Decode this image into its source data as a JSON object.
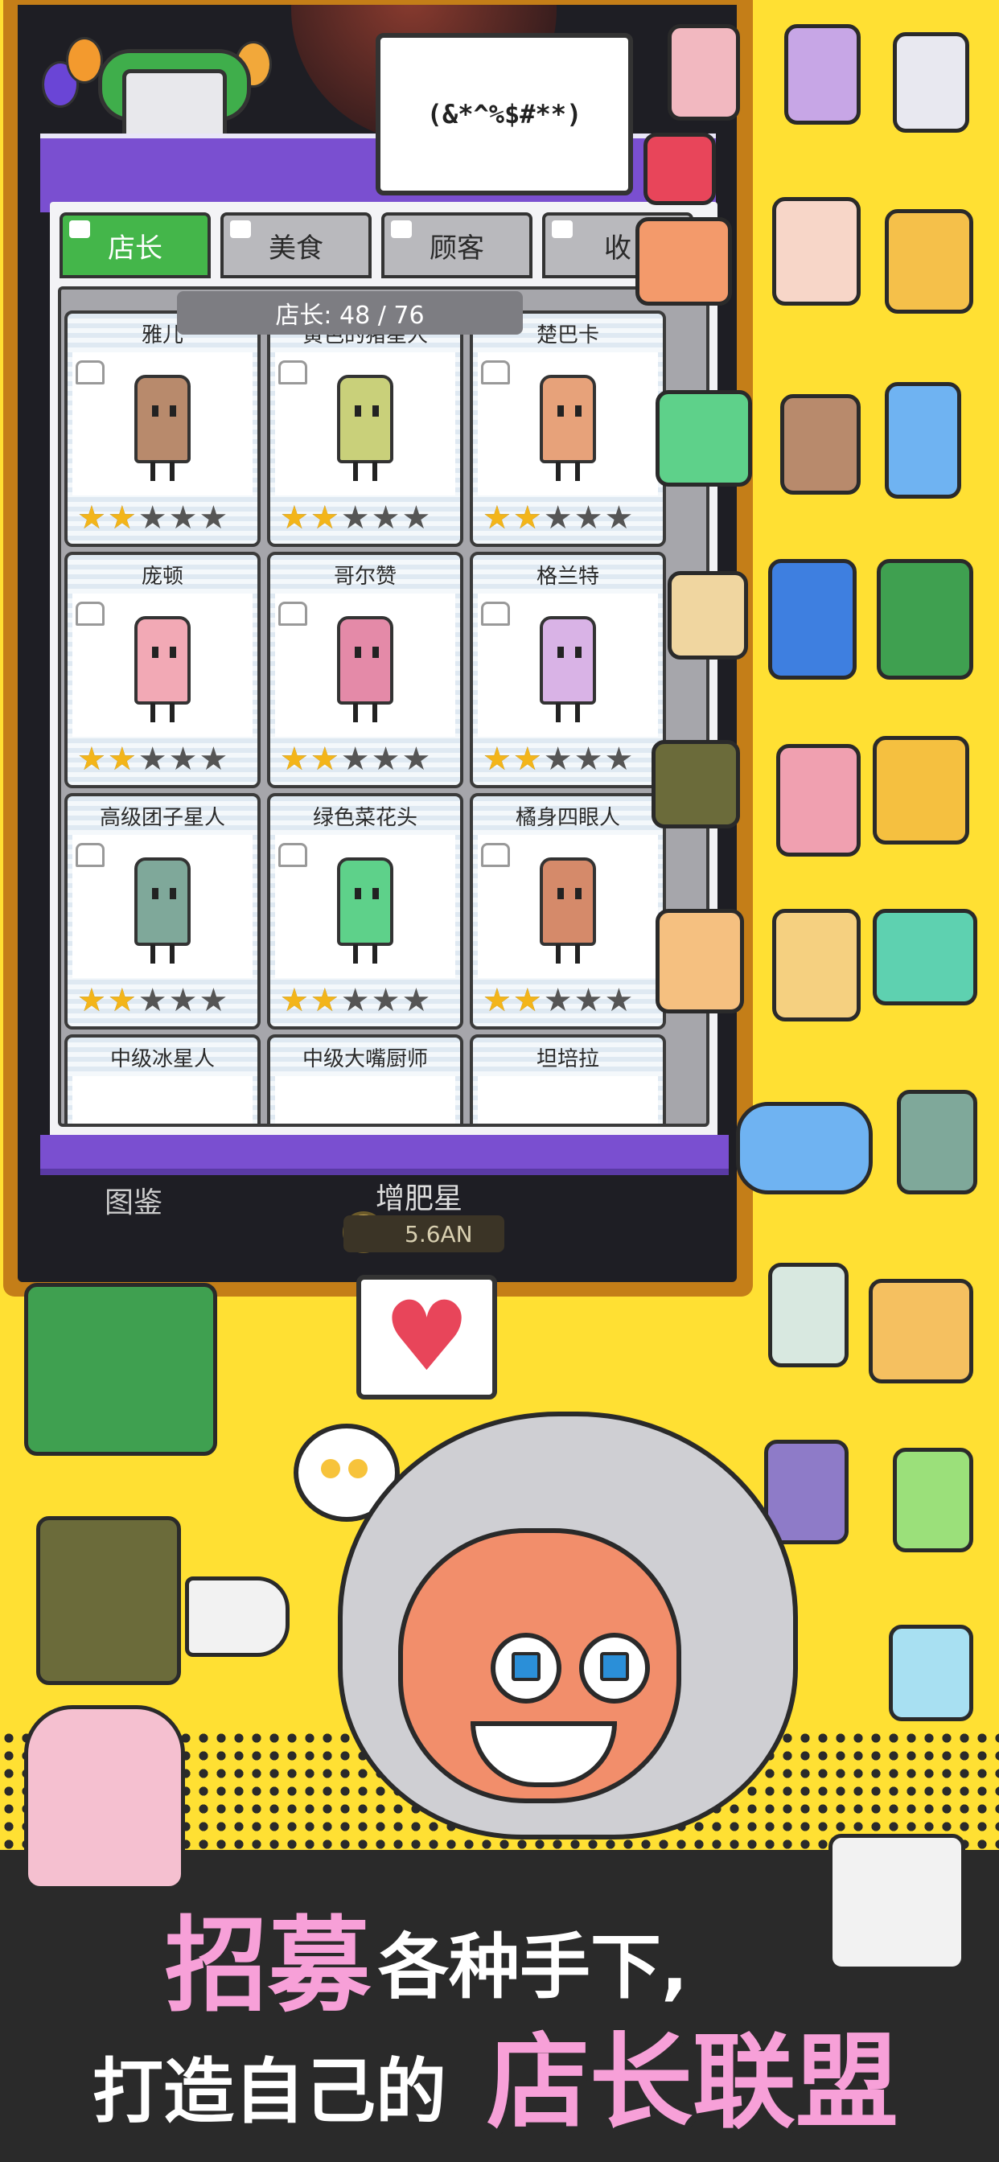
{
  "bubble_text": "(&*^%$#**)",
  "tabs": [
    {
      "label": "店长",
      "active": true
    },
    {
      "label": "美食",
      "active": false
    },
    {
      "label": "顾客",
      "active": false
    },
    {
      "label": "收",
      "active": false
    }
  ],
  "counter": "店长: 48 / 76",
  "cards": [
    {
      "name": "雅儿",
      "stars": 2,
      "color": "#B88A6C"
    },
    {
      "name": "黄色的猪星人",
      "stars": 2,
      "color": "#C9D07A"
    },
    {
      "name": "楚巴卡",
      "stars": 2,
      "color": "#E7A27A"
    },
    {
      "name": "庞顿",
      "stars": 2,
      "color": "#F2A9B5"
    },
    {
      "name": "哥尔赞",
      "stars": 2,
      "color": "#E48AA8"
    },
    {
      "name": "格兰特",
      "stars": 2,
      "color": "#D9B3E6"
    },
    {
      "name": "高级团子星人",
      "stars": 2,
      "color": "#7FA89A"
    },
    {
      "name": "绿色菜花头",
      "stars": 2,
      "color": "#5ED18A"
    },
    {
      "name": "橘身四眼人",
      "stars": 2,
      "color": "#D58A6A"
    },
    {
      "name": "中级冰星人",
      "stars": 0,
      "color": "#9AC4E8"
    },
    {
      "name": "中级大嘴厨师",
      "stars": 0,
      "color": "#E8C89A"
    },
    {
      "name": "坦培拉",
      "stars": 0,
      "color": "#E8B4A0"
    }
  ],
  "bottom_left_label": "图鉴",
  "bottom_center_label": "增肥星",
  "money": "5.6AN",
  "headline_line1_a": "招募",
  "headline_line1_b": "各种手下,",
  "headline_line2_a": "打造自己的",
  "headline_line2_b": "店长联盟",
  "colors": {
    "background": "#FFE033",
    "tab_active": "#44B64A",
    "panel_purple": "#7A4FD0",
    "star": "#F3B51A"
  }
}
